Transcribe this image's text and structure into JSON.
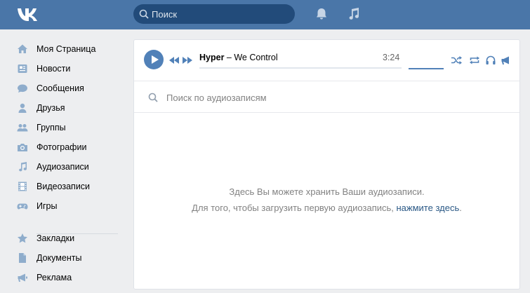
{
  "header": {
    "logo": "vk-logo",
    "search_placeholder": "Поиск",
    "icons": [
      "bell-icon",
      "music-note-icon"
    ]
  },
  "sidebar": {
    "items": [
      {
        "label": "Моя Страница",
        "icon": "home-icon"
      },
      {
        "label": "Новости",
        "icon": "news-icon"
      },
      {
        "label": "Сообщения",
        "icon": "messages-icon"
      },
      {
        "label": "Друзья",
        "icon": "user-icon"
      },
      {
        "label": "Группы",
        "icon": "users-icon"
      },
      {
        "label": "Фотографии",
        "icon": "camera-icon"
      },
      {
        "label": "Аудиозаписи",
        "icon": "music-note-icon"
      },
      {
        "label": "Видеозаписи",
        "icon": "film-icon"
      },
      {
        "label": "Игры",
        "icon": "gamepad-icon"
      }
    ],
    "secondary_items": [
      {
        "label": "Закладки",
        "icon": "star-icon"
      },
      {
        "label": "Документы",
        "icon": "document-icon"
      },
      {
        "label": "Реклама",
        "icon": "megaphone-icon"
      }
    ]
  },
  "player": {
    "artist": "Hyper",
    "separator": " – ",
    "title": "We Control",
    "duration": "3:24",
    "progress": 0,
    "volume": 1.0
  },
  "audio_search": {
    "placeholder": "Поиск по аудиозаписям"
  },
  "empty_state": {
    "line1": "Здесь Вы можете хранить Ваши аудиозаписи.",
    "line2_prefix": "Для того, чтобы загрузить первую аудиозапись, ",
    "line2_link": "нажмите здесь",
    "line2_suffix": "."
  },
  "colors": {
    "header_bg": "#4a76a8",
    "accent": "#5181b8",
    "link": "#2a5885",
    "page_bg": "#edeef0"
  }
}
